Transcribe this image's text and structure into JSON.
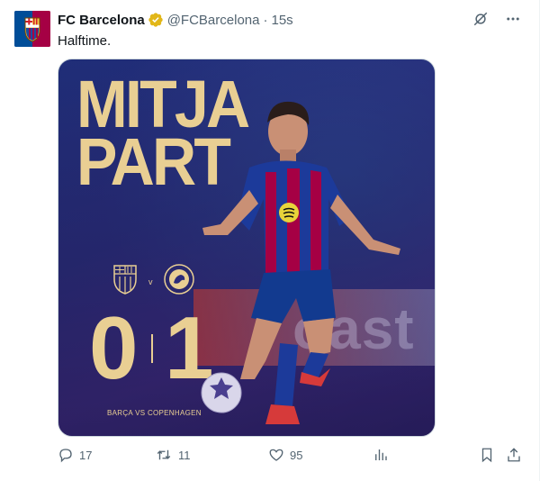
{
  "tweet": {
    "author_name": "FC Barcelona",
    "handle": "@FCBarcelona",
    "separator": "·",
    "time": "15s",
    "text": "Halftime."
  },
  "media": {
    "title_line1": "MITJA",
    "title_line2": "PART",
    "versus": "v",
    "score_home": "0",
    "score_away": "1",
    "match_label": "BARÇA VS COPENHAGEN",
    "banner_text": "oast"
  },
  "actions": {
    "replies": "17",
    "reposts": "11",
    "likes": "95"
  },
  "icons": {
    "verified": "verified-badge-icon",
    "grok": "grok-icon",
    "more": "more-icon",
    "reply": "reply-icon",
    "repost": "repost-icon",
    "like": "heart-icon",
    "views": "views-icon",
    "bookmark": "bookmark-icon",
    "share": "share-icon"
  },
  "colors": {
    "gold": "#e9cf93",
    "secondary_text": "#536471",
    "verified_gold": "#e2b719",
    "barca_blue": "#004d98",
    "barca_red": "#a50044"
  }
}
